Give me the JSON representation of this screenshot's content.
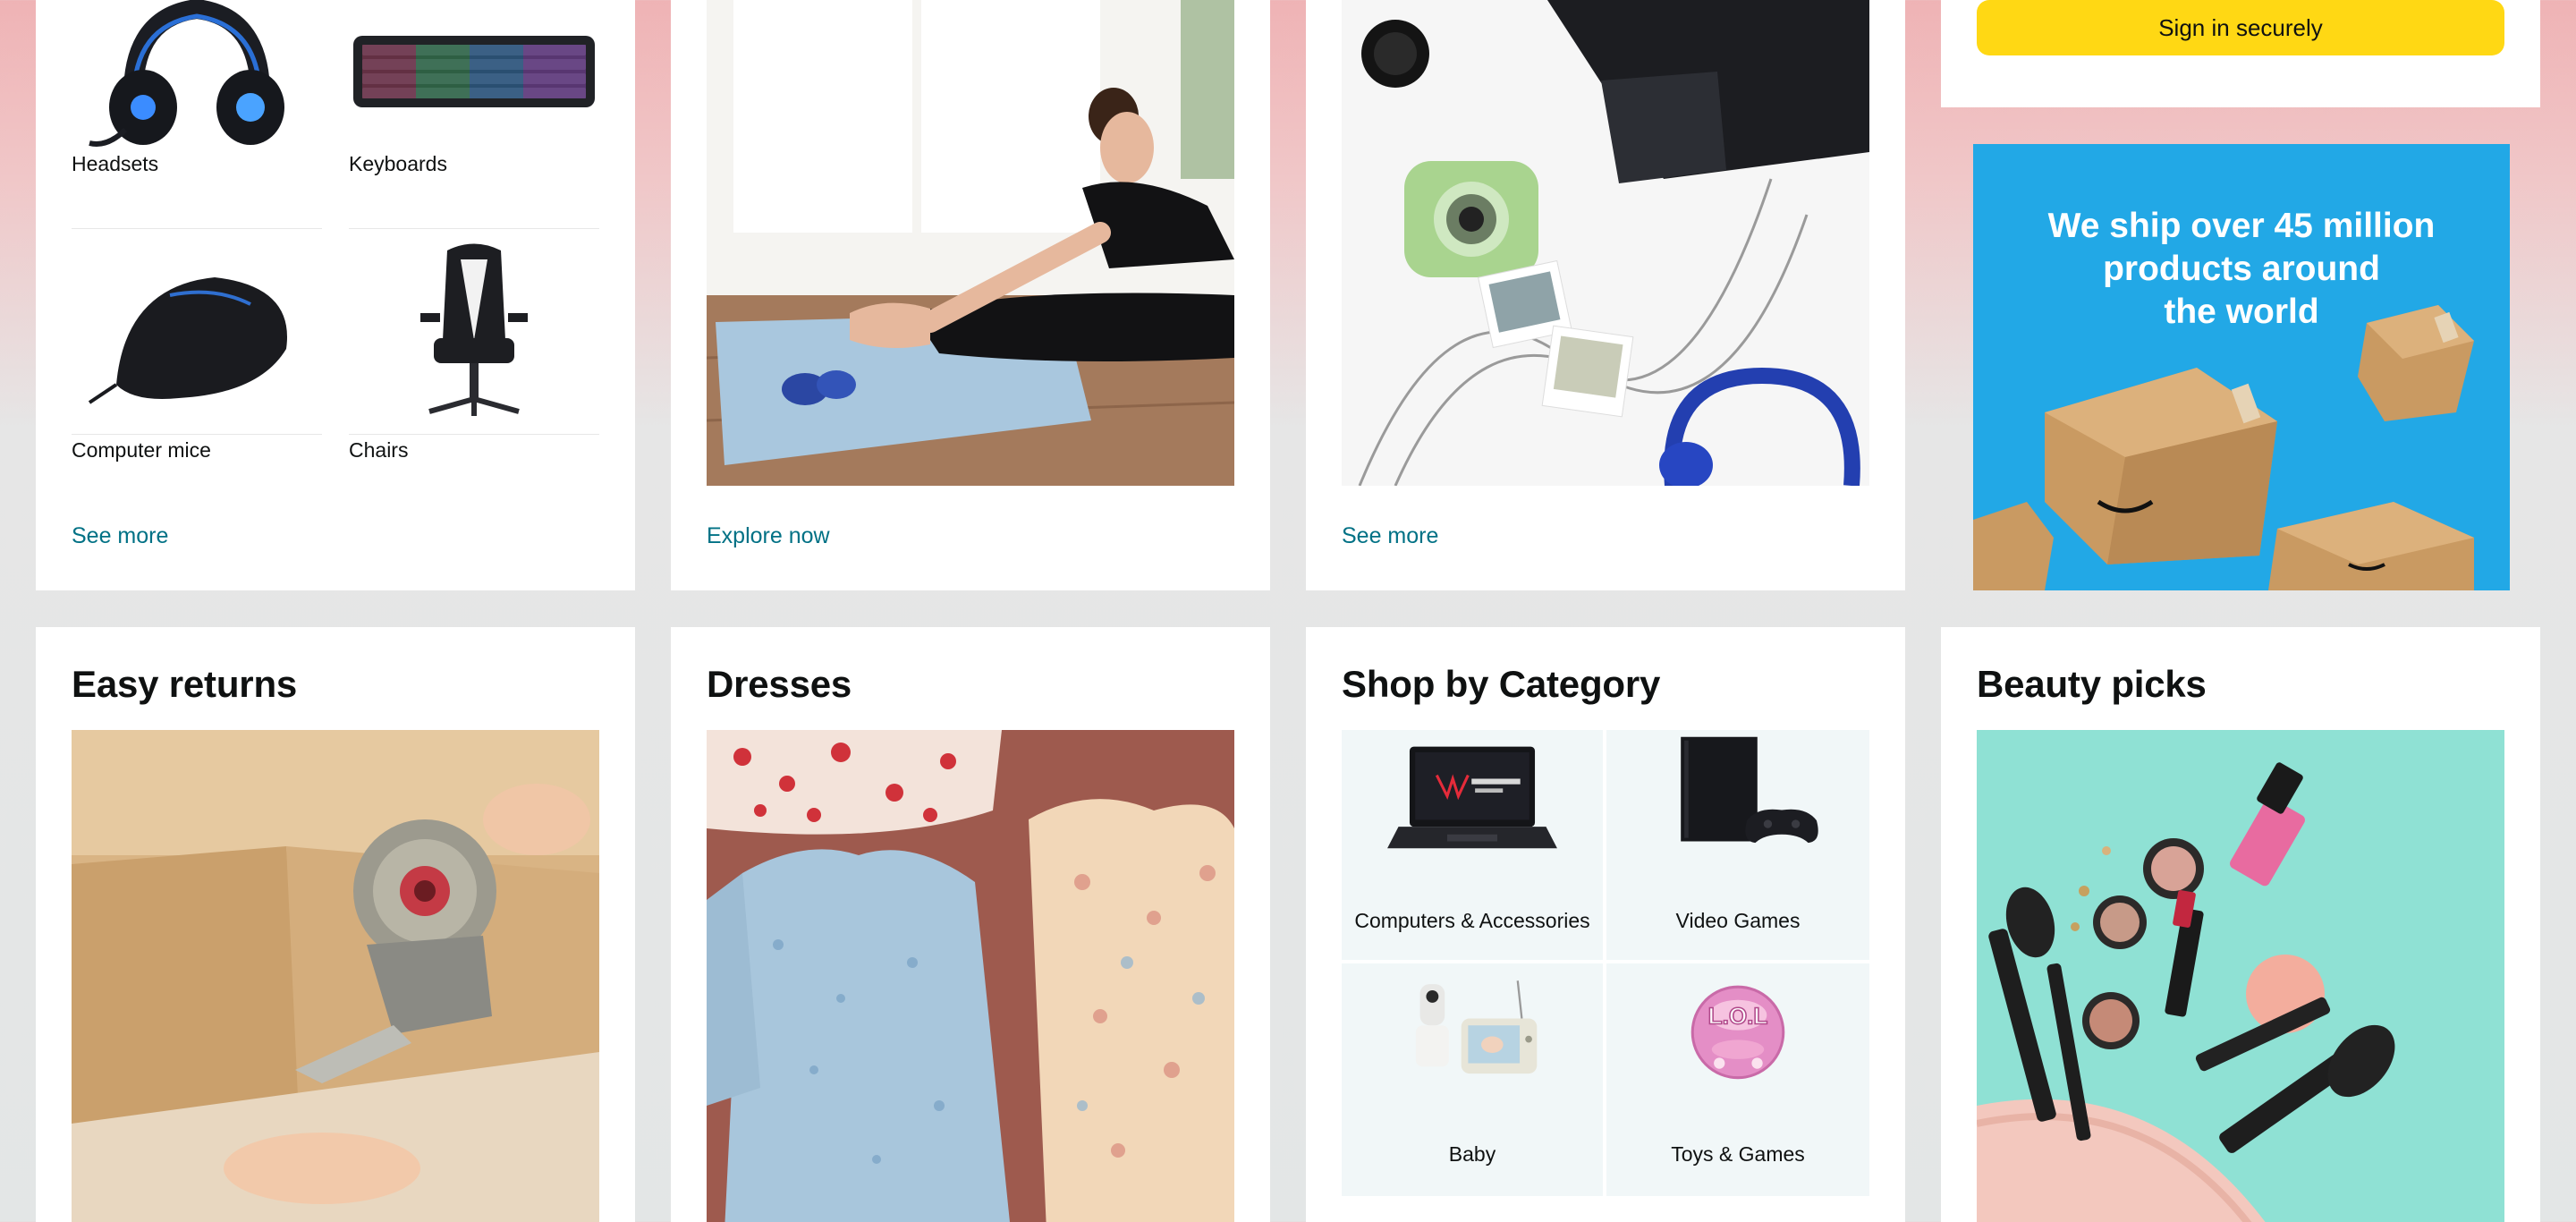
{
  "row1": {
    "gaming": {
      "tiles": [
        {
          "label": "Headsets"
        },
        {
          "label": "Keyboards"
        },
        {
          "label": "Computer mice"
        },
        {
          "label": "Chairs"
        }
      ],
      "link": "See more"
    },
    "fitness": {
      "link": "Explore now"
    },
    "desk": {
      "link": "See more"
    },
    "signin": {
      "button": "Sign in securely"
    },
    "ship_banner": {
      "line1": "We ship over 45 million",
      "line2": "products around",
      "line3": "the world"
    }
  },
  "row2": {
    "returns": {
      "title": "Easy returns"
    },
    "dresses": {
      "title": "Dresses"
    },
    "category": {
      "title": "Shop by Category",
      "items": [
        {
          "label": "Computers & Accessories",
          "icon": "laptop-icon"
        },
        {
          "label": "Video Games",
          "icon": "game-console-icon"
        },
        {
          "label": "Baby",
          "icon": "baby-monitor-icon"
        },
        {
          "label": "Toys & Games",
          "icon": "toy-ball-icon"
        }
      ]
    },
    "beauty": {
      "title": "Beauty picks"
    }
  },
  "colors": {
    "link": "#007185",
    "signin_button": "#ffd814",
    "ship_banner": "#22a8e6"
  }
}
